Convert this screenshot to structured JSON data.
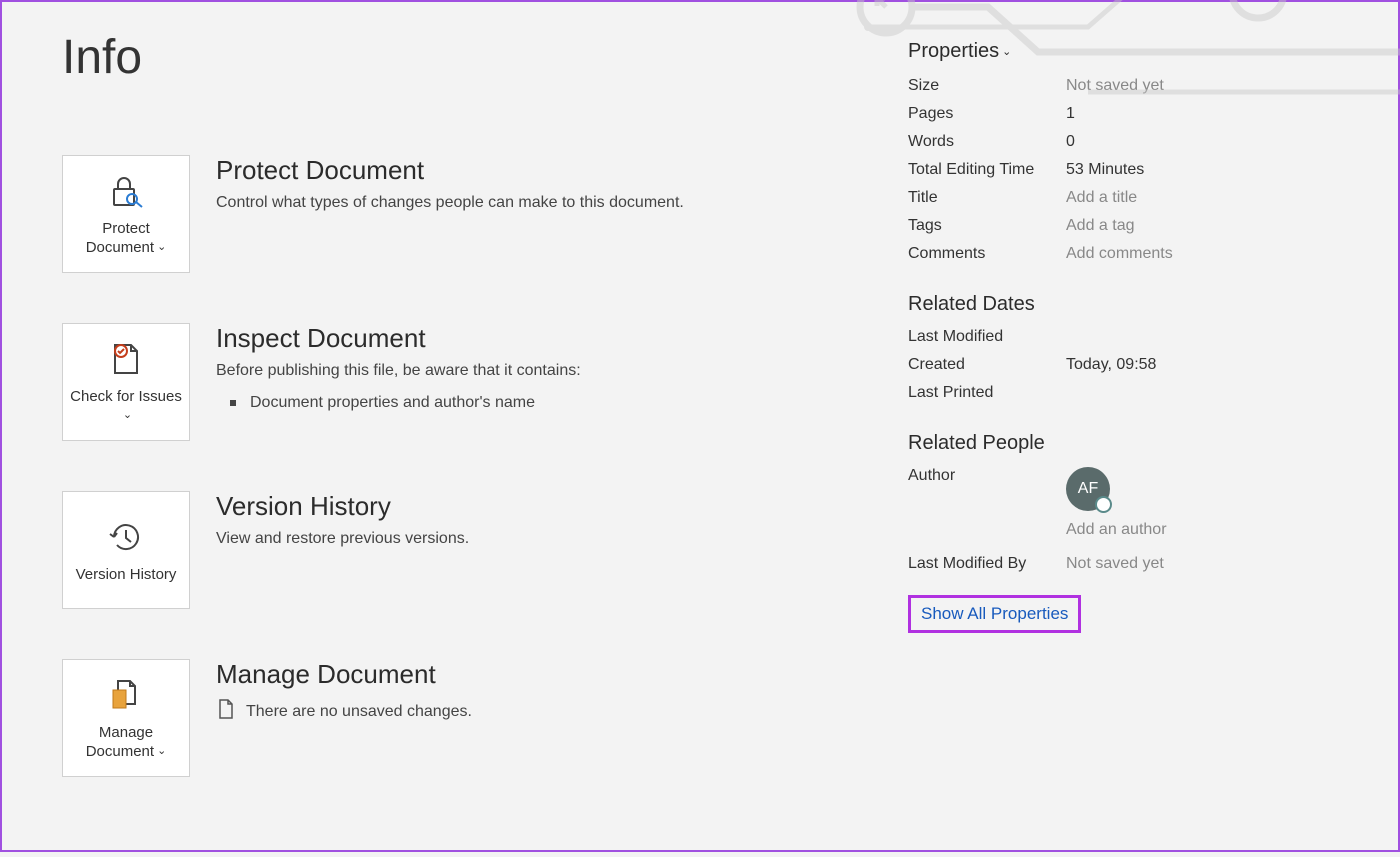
{
  "page_title": "Info",
  "tiles": {
    "protect": {
      "label": "Protect Document",
      "has_dropdown": true
    },
    "check": {
      "label": "Check for Issues",
      "has_dropdown": true
    },
    "version": {
      "label": "Version History",
      "has_dropdown": false
    },
    "manage": {
      "label": "Manage Document",
      "has_dropdown": true
    }
  },
  "sections": {
    "protect": {
      "title": "Protect Document",
      "desc": "Control what types of changes people can make to this document."
    },
    "inspect": {
      "title": "Inspect Document",
      "desc": "Before publishing this file, be aware that it contains:",
      "bullets": [
        "Document properties and author's name"
      ]
    },
    "version": {
      "title": "Version History",
      "desc": "View and restore previous versions."
    },
    "manage": {
      "title": "Manage Document",
      "desc": "There are no unsaved changes."
    }
  },
  "properties_header": "Properties",
  "properties": {
    "size": {
      "label": "Size",
      "value": "Not saved yet",
      "placeholder": true
    },
    "pages": {
      "label": "Pages",
      "value": "1"
    },
    "words": {
      "label": "Words",
      "value": "0"
    },
    "edit_time": {
      "label": "Total Editing Time",
      "value": "53 Minutes"
    },
    "title": {
      "label": "Title",
      "value": "Add a title",
      "placeholder": true
    },
    "tags": {
      "label": "Tags",
      "value": "Add a tag",
      "placeholder": true
    },
    "comments": {
      "label": "Comments",
      "value": "Add comments",
      "placeholder": true
    }
  },
  "related_dates_header": "Related Dates",
  "related_dates": {
    "modified": {
      "label": "Last Modified",
      "value": ""
    },
    "created": {
      "label": "Created",
      "value": "Today, 09:58"
    },
    "printed": {
      "label": "Last Printed",
      "value": ""
    }
  },
  "related_people_header": "Related People",
  "author_label": "Author",
  "author_initials": "AF",
  "add_author_placeholder": "Add an author",
  "last_modified_by_label": "Last Modified By",
  "last_modified_by_value": "Not saved yet",
  "show_all": "Show All Properties"
}
